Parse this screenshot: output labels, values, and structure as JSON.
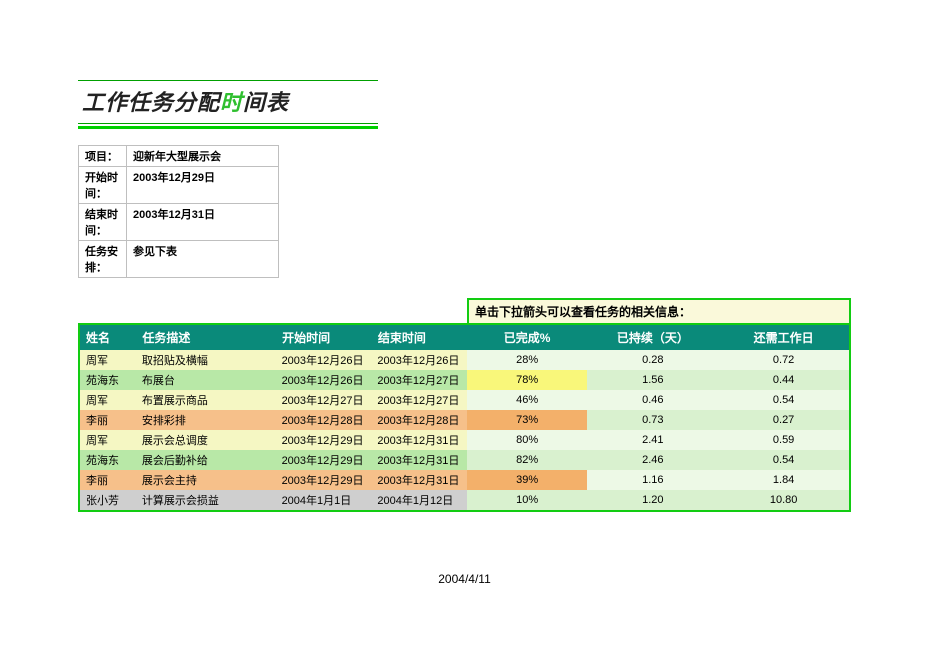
{
  "title_parts": {
    "pre": "工作任务分配",
    "accent": "时",
    "post": "间表"
  },
  "info": {
    "project_label": "项目：",
    "project_value": "迎新年大型展示会",
    "start_label": "开始时间：",
    "start_value": "2003年12月29日",
    "end_label": "结束时间：",
    "end_value": "2003年12月31日",
    "plan_label": "任务安排：",
    "plan_value": "参见下表"
  },
  "hint": "单击下拉箭头可以查看任务的相关信息：",
  "headers": {
    "name": "姓名",
    "desc": "任务描述",
    "start": "开始时间",
    "end": "结束时间",
    "pct": "已完成%",
    "dur": "已持续（天）",
    "rem": "还需工作日"
  },
  "rows": [
    {
      "name": "周军",
      "desc": "取招贴及横幅",
      "start": "2003年12月26日",
      "end": "2003年12月26日",
      "pct": "28%",
      "dur": "0.28",
      "rem": "0.72",
      "lb": "lb-yellow",
      "rb": "rb",
      "pcthl": ""
    },
    {
      "name": "苑海东",
      "desc": "布展台",
      "start": "2003年12月26日",
      "end": "2003年12月27日",
      "pct": "78%",
      "dur": "1.56",
      "rem": "0.44",
      "lb": "lb-green",
      "rb": "rb-alt",
      "pcthl": "hl-yellow"
    },
    {
      "name": "周军",
      "desc": "布置展示商品",
      "start": "2003年12月27日",
      "end": "2003年12月27日",
      "pct": "46%",
      "dur": "0.46",
      "rem": "0.54",
      "lb": "lb-yellow",
      "rb": "rb",
      "pcthl": ""
    },
    {
      "name": "李丽",
      "desc": "安排彩排",
      "start": "2003年12月28日",
      "end": "2003年12月28日",
      "pct": "73%",
      "dur": "0.73",
      "rem": "0.27",
      "lb": "lb-orange",
      "rb": "rb-alt",
      "pcthl": "hl-orange"
    },
    {
      "name": "周军",
      "desc": "展示会总调度",
      "start": "2003年12月29日",
      "end": "2003年12月31日",
      "pct": "80%",
      "dur": "2.41",
      "rem": "0.59",
      "lb": "lb-yellow",
      "rb": "rb",
      "pcthl": ""
    },
    {
      "name": "苑海东",
      "desc": "展会后勤补给",
      "start": "2003年12月29日",
      "end": "2003年12月31日",
      "pct": "82%",
      "dur": "2.46",
      "rem": "0.54",
      "lb": "lb-green",
      "rb": "rb-alt",
      "pcthl": ""
    },
    {
      "name": "李丽",
      "desc": "展示会主持",
      "start": "2003年12月29日",
      "end": "2003年12月31日",
      "pct": "39%",
      "dur": "1.16",
      "rem": "1.84",
      "lb": "lb-orange",
      "rb": "rb",
      "pcthl": "hl-orange"
    },
    {
      "name": "张小芳",
      "desc": "计算展示会损益",
      "start": "2004年1月1日",
      "end": "2004年1月12日",
      "pct": "10%",
      "dur": "1.20",
      "rem": "10.80",
      "lb": "lb-grey",
      "rb": "rb-alt",
      "pcthl": ""
    }
  ],
  "footer_date": "2004/4/11",
  "chart_data": {
    "type": "table",
    "title": "工作任务分配时间表",
    "columns": [
      "姓名",
      "任务描述",
      "开始时间",
      "结束时间",
      "已完成%",
      "已持续（天）",
      "还需工作日"
    ],
    "rows": [
      [
        "周军",
        "取招贴及横幅",
        "2003-12-26",
        "2003-12-26",
        28,
        0.28,
        0.72
      ],
      [
        "苑海东",
        "布展台",
        "2003-12-26",
        "2003-12-27",
        78,
        1.56,
        0.44
      ],
      [
        "周军",
        "布置展示商品",
        "2003-12-27",
        "2003-12-27",
        46,
        0.46,
        0.54
      ],
      [
        "李丽",
        "安排彩排",
        "2003-12-28",
        "2003-12-28",
        73,
        0.73,
        0.27
      ],
      [
        "周军",
        "展示会总调度",
        "2003-12-29",
        "2003-12-31",
        80,
        2.41,
        0.59
      ],
      [
        "苑海东",
        "展会后勤补给",
        "2003-12-29",
        "2003-12-31",
        82,
        2.46,
        0.54
      ],
      [
        "李丽",
        "展示会主持",
        "2003-12-29",
        "2003-12-31",
        39,
        1.16,
        1.84
      ],
      [
        "张小芳",
        "计算展示会损益",
        "2004-01-01",
        "2004-01-12",
        10,
        1.2,
        10.8
      ]
    ]
  }
}
